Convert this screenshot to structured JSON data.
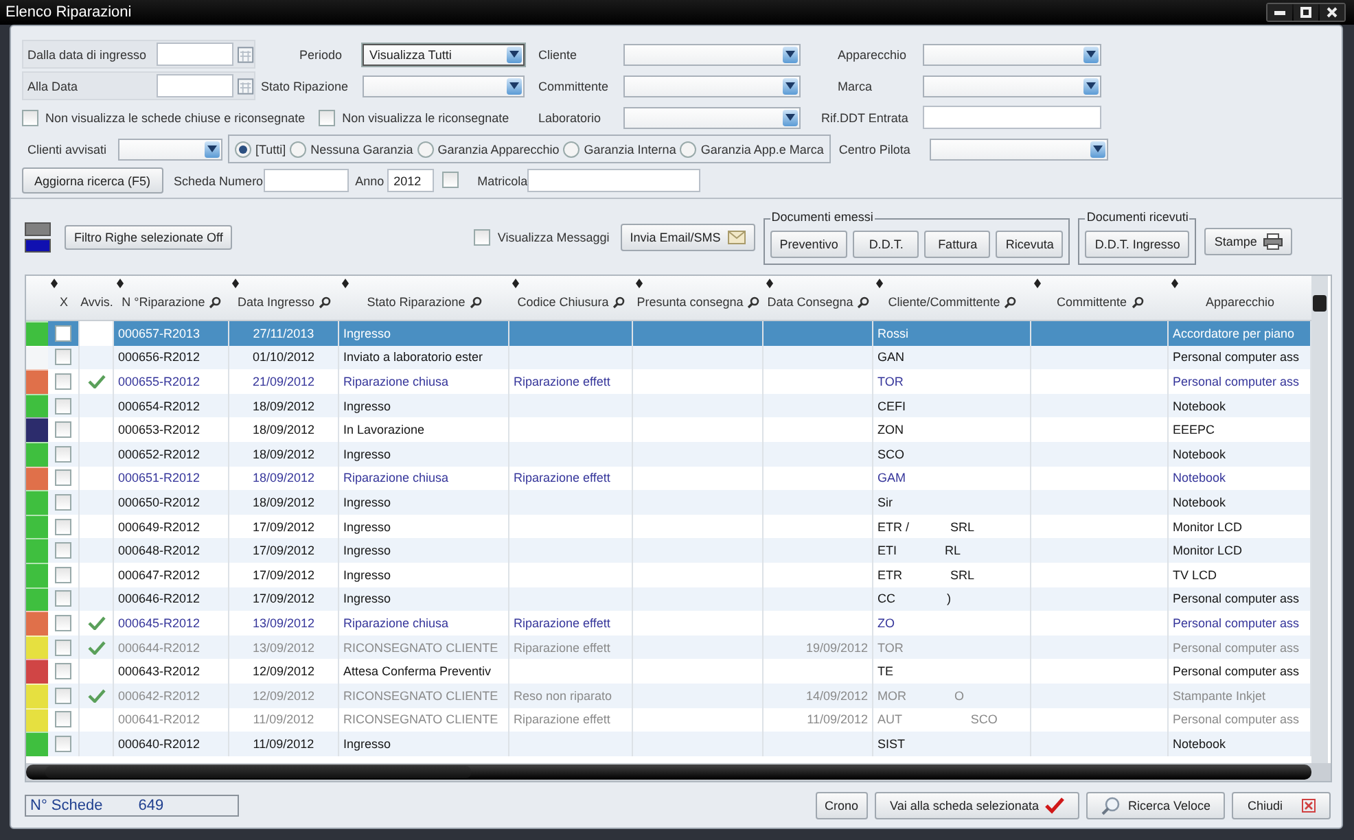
{
  "window": {
    "title": "Elenco Riparazioni"
  },
  "filters": {
    "dalla_data": {
      "label": "Dalla data di ingresso"
    },
    "alla_data": {
      "label": "Alla Data"
    },
    "periodo": {
      "label": "Periodo",
      "value": "Visualizza Tutti"
    },
    "stato": {
      "label": "Stato Ripazione"
    },
    "cliente": {
      "label": "Cliente"
    },
    "committente": {
      "label": "Committente"
    },
    "laboratorio": {
      "label": "Laboratorio"
    },
    "apparecchio": {
      "label": "Apparecchio"
    },
    "marca": {
      "label": "Marca"
    },
    "rif_ddt": {
      "label": "Rif.DDT Entrata"
    },
    "centro_pilota": {
      "label": "Centro Pilota"
    },
    "checks": [
      {
        "label": "Non visualizza le schede chiuse e riconsegnate",
        "checked": false
      },
      {
        "label": "Non visualizza le riconsegnate",
        "checked": false
      }
    ],
    "clienti_avvisati": {
      "label": "Clienti avvisati"
    },
    "garanzia": [
      {
        "label": "[Tutti]",
        "selected": true
      },
      {
        "label": "Nessuna Garanzia",
        "selected": false
      },
      {
        "label": "Garanzia Apparecchio",
        "selected": false
      },
      {
        "label": "Garanzia Interna",
        "selected": false
      },
      {
        "label": "Garanzia App.e Marca",
        "selected": false
      }
    ],
    "aggiorna": "Aggiorna ricerca (F5)",
    "scheda_numero": {
      "label": "Scheda Numero"
    },
    "anno": {
      "label": "Anno",
      "value": "2012",
      "checked": false
    },
    "matricola": {
      "label": "Matricola"
    }
  },
  "toolbar": {
    "filtro": "Filtro Righe selezionate Off",
    "messaggi": {
      "label": "Visualizza Messaggi",
      "checked": false
    },
    "email": "Invia Email/SMS",
    "emessi": {
      "title": "Documenti emessi",
      "buttons": [
        "Preventivo",
        "D.D.T.",
        "Fattura",
        "Ricevuta"
      ]
    },
    "ricevuti": {
      "title": "Documenti ricevuti",
      "buttons": [
        "D.D.T. Ingresso"
      ]
    },
    "stampe": "Stampe"
  },
  "table": {
    "columns": [
      {
        "label": "X",
        "search": false
      },
      {
        "label": "Avvis.",
        "search": false
      },
      {
        "label": "N °Riparazione",
        "search": true
      },
      {
        "label": "Data Ingresso",
        "search": true
      },
      {
        "label": "Stato Riparazione",
        "search": true
      },
      {
        "label": "Codice Chiusura",
        "search": true
      },
      {
        "label": "Presunta consegna",
        "search": true
      },
      {
        "label": "Data Consegna",
        "search": true
      },
      {
        "label": "Cliente/Committente",
        "search": true
      },
      {
        "label": "Committente",
        "search": true
      },
      {
        "label": "Apparecchio",
        "search": false
      }
    ],
    "rows": [
      {
        "color": "#3fbf3f",
        "checked": false,
        "notified": false,
        "selected": true,
        "kind": "normal",
        "cells": [
          "",
          "",
          "000657-R2013",
          "27/11/2013",
          "Ingresso",
          "",
          "",
          "",
          "Rossi",
          "",
          "Accordatore per piano"
        ]
      },
      {
        "color": "#f4f6f8",
        "checked": false,
        "notified": false,
        "selected": false,
        "kind": "normal",
        "cells": [
          "",
          "",
          "000656-R2012",
          "01/10/2012",
          "Inviato a laboratorio ester",
          "",
          "",
          "",
          "GAN",
          "",
          "Personal computer ass"
        ]
      },
      {
        "color": "#e0704a",
        "checked": false,
        "notified": true,
        "selected": false,
        "kind": "closed",
        "cells": [
          "",
          "",
          "000655-R2012",
          "21/09/2012",
          "Riparazione chiusa",
          "Riparazione effett",
          "",
          "",
          "TOR",
          "",
          "Personal computer ass"
        ]
      },
      {
        "color": "#3fbf3f",
        "checked": false,
        "notified": false,
        "selected": false,
        "kind": "normal",
        "cells": [
          "",
          "",
          "000654-R2012",
          "18/09/2012",
          "Ingresso",
          "",
          "",
          "",
          "CEFI",
          "",
          "Notebook"
        ]
      },
      {
        "color": "#2c2c6c",
        "checked": false,
        "notified": false,
        "selected": false,
        "kind": "normal",
        "cells": [
          "",
          "",
          "000653-R2012",
          "18/09/2012",
          "In Lavorazione",
          "",
          "",
          "",
          "ZON",
          "",
          "EEEPC"
        ]
      },
      {
        "color": "#3fbf3f",
        "checked": false,
        "notified": false,
        "selected": false,
        "kind": "normal",
        "cells": [
          "",
          "",
          "000652-R2012",
          "18/09/2012",
          "Ingresso",
          "",
          "",
          "",
          "SCO",
          "",
          "Notebook"
        ]
      },
      {
        "color": "#e0704a",
        "checked": false,
        "notified": false,
        "selected": false,
        "kind": "closed",
        "cells": [
          "",
          "",
          "000651-R2012",
          "18/09/2012",
          "Riparazione chiusa",
          "Riparazione effett",
          "",
          "",
          "GAM",
          "",
          "Notebook"
        ]
      },
      {
        "color": "#3fbf3f",
        "checked": false,
        "notified": false,
        "selected": false,
        "kind": "normal",
        "cells": [
          "",
          "",
          "000650-R2012",
          "18/09/2012",
          "Ingresso",
          "",
          "",
          "",
          "Sir",
          "",
          "Notebook"
        ]
      },
      {
        "color": "#3fbf3f",
        "checked": false,
        "notified": false,
        "selected": false,
        "kind": "normal",
        "cells": [
          "",
          "",
          "000649-R2012",
          "17/09/2012",
          "Ingresso",
          "",
          "",
          "",
          "ETR /            SRL",
          "",
          "Monitor LCD"
        ]
      },
      {
        "color": "#3fbf3f",
        "checked": false,
        "notified": false,
        "selected": false,
        "kind": "normal",
        "cells": [
          "",
          "",
          "000648-R2012",
          "17/09/2012",
          "Ingresso",
          "",
          "",
          "",
          "ETI              RL",
          "",
          "Monitor LCD"
        ]
      },
      {
        "color": "#3fbf3f",
        "checked": false,
        "notified": false,
        "selected": false,
        "kind": "normal",
        "cells": [
          "",
          "",
          "000647-R2012",
          "17/09/2012",
          "Ingresso",
          "",
          "",
          "",
          "ETR              SRL",
          "",
          "TV LCD"
        ]
      },
      {
        "color": "#3fbf3f",
        "checked": false,
        "notified": false,
        "selected": false,
        "kind": "normal",
        "cells": [
          "",
          "",
          "000646-R2012",
          "17/09/2012",
          "Ingresso",
          "",
          "",
          "",
          "CC               )",
          "",
          "Personal computer ass"
        ]
      },
      {
        "color": "#e0704a",
        "checked": false,
        "notified": true,
        "selected": false,
        "kind": "closed",
        "cells": [
          "",
          "",
          "000645-R2012",
          "13/09/2012",
          "Riparazione chiusa",
          "Riparazione effett",
          "",
          "",
          "ZO",
          "",
          "Personal computer ass"
        ]
      },
      {
        "color": "#e6e040",
        "checked": false,
        "notified": true,
        "selected": false,
        "kind": "returned",
        "cells": [
          "",
          "",
          "000644-R2012",
          "13/09/2012",
          "RICONSEGNATO CLIENTE",
          "Riparazione effett",
          "",
          "19/09/2012",
          "TOR",
          "",
          "Personal computer ass"
        ]
      },
      {
        "color": "#d04545",
        "checked": false,
        "notified": false,
        "selected": false,
        "kind": "normal",
        "cells": [
          "",
          "",
          "000643-R2012",
          "12/09/2012",
          "Attesa Conferma Preventiv",
          "",
          "",
          "",
          "TE",
          "",
          "Personal computer ass"
        ]
      },
      {
        "color": "#e6e040",
        "checked": false,
        "notified": true,
        "selected": false,
        "kind": "returned",
        "cells": [
          "",
          "",
          "000642-R2012",
          "12/09/2012",
          "RICONSEGNATO CLIENTE",
          "Reso non riparato",
          "",
          "14/09/2012",
          "MOR              O",
          "",
          "Stampante Inkjet"
        ]
      },
      {
        "color": "#e6e040",
        "checked": false,
        "notified": false,
        "selected": false,
        "kind": "returned",
        "cells": [
          "",
          "",
          "000641-R2012",
          "11/09/2012",
          "RICONSEGNATO CLIENTE",
          "Riparazione effett",
          "",
          "11/09/2012",
          "AUT                    SCO",
          "",
          "Personal computer ass"
        ]
      },
      {
        "color": "#3fbf3f",
        "checked": false,
        "notified": false,
        "selected": false,
        "kind": "normal",
        "cells": [
          "",
          "",
          "000640-R2012",
          "11/09/2012",
          "Ingresso",
          "",
          "",
          "",
          "SIST",
          "",
          "Notebook"
        ]
      }
    ]
  },
  "footer": {
    "count_label": "N° Schede",
    "count": "649",
    "buttons": [
      {
        "label": "Crono",
        "kind": "plain"
      },
      {
        "label": "Vai alla scheda selezionata",
        "kind": "check"
      },
      {
        "label": "Ricerca Veloce",
        "kind": "search"
      },
      {
        "label": "Chiudi",
        "kind": "close"
      }
    ]
  }
}
